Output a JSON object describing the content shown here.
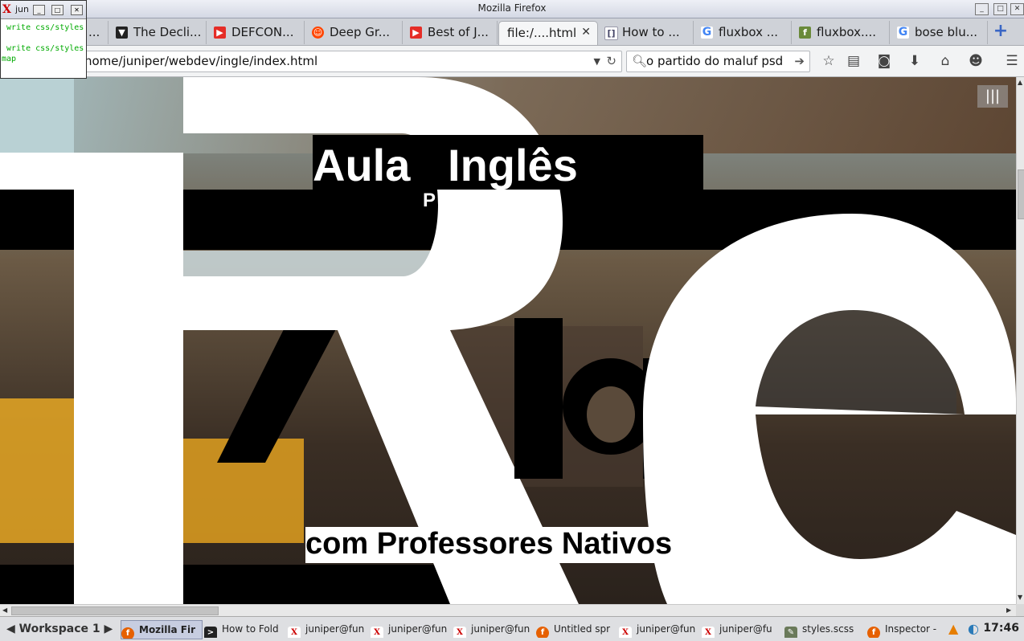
{
  "window": {
    "title": "Mozilla Firefox"
  },
  "terminal": {
    "name": "jun",
    "lines": [
      "write css/styles",
      "write css/styles",
      "map"
    ]
  },
  "tabs": [
    {
      "label": "...",
      "icon": "generic-icon"
    },
    {
      "label": "The Decli...",
      "icon": "bird-icon"
    },
    {
      "label": "DEFCON...",
      "icon": "youtube-icon"
    },
    {
      "label": "Deep Gr...",
      "icon": "reddit-icon"
    },
    {
      "label": "Best of J...",
      "icon": "youtube-icon"
    },
    {
      "label": "file:/....html",
      "icon": "",
      "active": true
    },
    {
      "label": "How to ...",
      "icon": "brackets-icon"
    },
    {
      "label": "fluxbox ...",
      "icon": "google-icon"
    },
    {
      "label": "fluxbox....",
      "icon": "fluxbox-icon"
    },
    {
      "label": "bose blu...",
      "icon": "google-icon"
    }
  ],
  "tab_close": "✕",
  "newtab": "+",
  "nav": {
    "url": "home/juniper/webdev/ingle/index.html",
    "search_value": "o partido do maluf psd"
  },
  "hero": {
    "heading": "Aula   Inglês",
    "subheading": "P              sivas",
    "tagline": "com Professores Nativos",
    "big_letters": "Re",
    "bg_letters": "A",
    "mid_letters": "la",
    "menu_icon": "|||"
  },
  "taskbar": {
    "workspace": "Workspace 1",
    "items": [
      {
        "label": "Mozilla Fir",
        "icon": "firefox-icon",
        "active": true
      },
      {
        "label": "How to Fold",
        "icon": "terminal-icon"
      },
      {
        "label": "juniper@fun",
        "icon": "xterm-icon"
      },
      {
        "label": "juniper@fun",
        "icon": "xterm-icon"
      },
      {
        "label": "juniper@fun",
        "icon": "xterm-icon"
      },
      {
        "label": "Untitled spr",
        "icon": "firefox-icon"
      },
      {
        "label": "juniper@fun",
        "icon": "xterm-icon"
      },
      {
        "label": "juniper@fu",
        "icon": "xterm-icon"
      },
      {
        "label": "styles.scss",
        "icon": "editor-icon"
      },
      {
        "label": "Inspector -",
        "icon": "firefox-icon"
      }
    ],
    "clock": "17:46"
  },
  "colors": {
    "accent": "#3a66c4",
    "youtube": "#e52d27",
    "page_black": "#000000",
    "page_white": "#ffffff"
  }
}
